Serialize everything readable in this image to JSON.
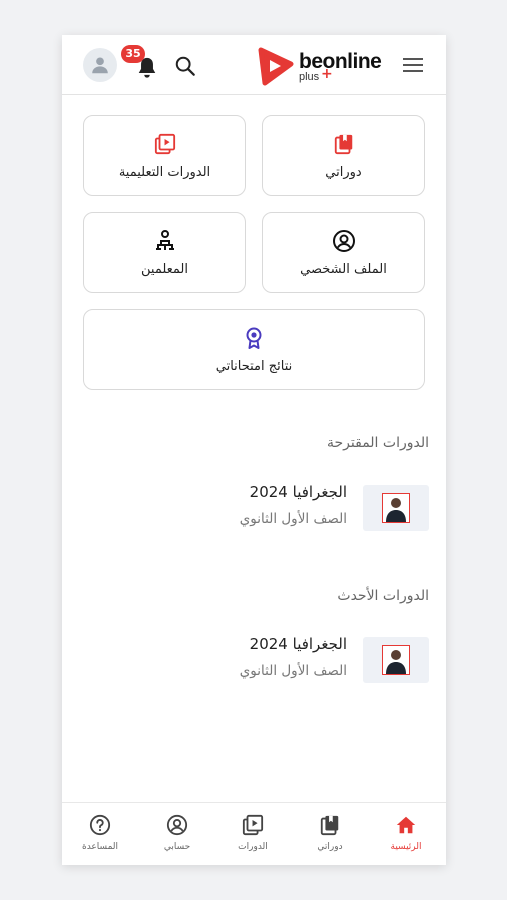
{
  "header": {
    "logo_main": "beonline",
    "logo_sub": "plus",
    "notifications_count": "35"
  },
  "tiles": [
    {
      "label": "دوراتي",
      "icon": "bookmark-book-icon"
    },
    {
      "label": "الدورات التعليمية",
      "icon": "video-library-icon"
    },
    {
      "label": "الملف الشخصي",
      "icon": "user-circle-icon"
    },
    {
      "label": "المعلمين",
      "icon": "teacher-icon"
    },
    {
      "label": "نتائج امتحاناتي",
      "icon": "award-icon"
    }
  ],
  "sections": {
    "suggested": {
      "title": "الدورات المقترحة",
      "course": {
        "title": "الجغرافيا 2024",
        "subtitle": "الصف الأول الثانوي"
      }
    },
    "latest": {
      "title": "الدورات الأحدث",
      "course": {
        "title": "الجغرافيا 2024",
        "subtitle": "الصف الأول الثانوي"
      }
    }
  },
  "bottom_nav": [
    {
      "label": "الرئيسية",
      "icon": "home-icon",
      "active": true
    },
    {
      "label": "دوراتي",
      "icon": "bookmark-book-icon",
      "active": false
    },
    {
      "label": "الدورات",
      "icon": "video-library-icon",
      "active": false
    },
    {
      "label": "حسابي",
      "icon": "user-circle-icon",
      "active": false
    },
    {
      "label": "المساعدة",
      "icon": "help-icon",
      "active": false
    }
  ],
  "colors": {
    "accent": "#e53935",
    "award": "#4a3bbf"
  }
}
